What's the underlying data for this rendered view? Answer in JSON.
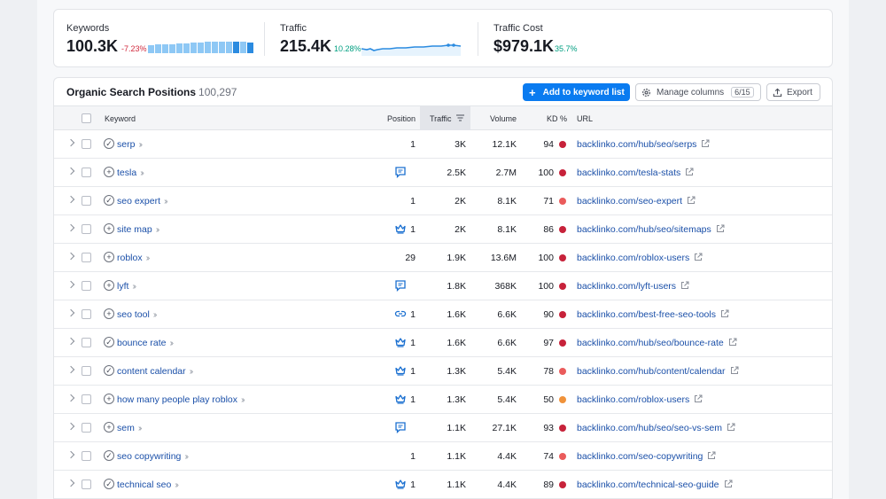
{
  "summary": {
    "keywords": {
      "label": "Keywords",
      "value": "100.3K",
      "change": "-7.23%",
      "change_color": "#d1293d"
    },
    "traffic": {
      "label": "Traffic",
      "value": "215.4K",
      "change": "10.28%",
      "change_color": "#009f81"
    },
    "traffic_cost": {
      "label": "Traffic Cost",
      "value": "$979.1K",
      "change": "35.7%",
      "change_color": "#009f81"
    }
  },
  "table": {
    "title": "Organic Search Positions",
    "count": "100,297",
    "add_button": "Add to keyword list",
    "manage_button": "Manage columns",
    "manage_badge": "6/15",
    "export_button": "Export",
    "headers": {
      "keyword": "Keyword",
      "position": "Position",
      "traffic": "Traffic",
      "volume": "Volume",
      "kd": "KD %",
      "url": "URL"
    },
    "rows": [
      {
        "intent": "check-circle-icon",
        "keyword": "serp",
        "feature": "",
        "position": "1",
        "traffic": "3K",
        "volume": "12.1K",
        "kd": "94",
        "kd_color": "#c7223a",
        "url": "backlinko.com/hub/seo/serps"
      },
      {
        "intent": "plus-circle-icon",
        "keyword": "tesla",
        "feature": "review-icon",
        "position": "",
        "traffic": "2.5K",
        "volume": "2.7M",
        "kd": "100",
        "kd_color": "#c7223a",
        "url": "backlinko.com/tesla-stats"
      },
      {
        "intent": "check-circle-icon",
        "keyword": "seo expert",
        "feature": "",
        "position": "1",
        "traffic": "2K",
        "volume": "8.1K",
        "kd": "71",
        "kd_color": "#ea5b5b",
        "url": "backlinko.com/seo-expert"
      },
      {
        "intent": "plus-circle-icon",
        "keyword": "site map",
        "feature": "crown-icon",
        "position": "1",
        "traffic": "2K",
        "volume": "8.1K",
        "kd": "86",
        "kd_color": "#c7223a",
        "url": "backlinko.com/hub/seo/sitemaps"
      },
      {
        "intent": "plus-circle-icon",
        "keyword": "roblox",
        "feature": "",
        "position": "29",
        "traffic": "1.9K",
        "volume": "13.6M",
        "kd": "100",
        "kd_color": "#c7223a",
        "url": "backlinko.com/roblox-users"
      },
      {
        "intent": "plus-circle-icon",
        "keyword": "lyft",
        "feature": "review-icon",
        "position": "",
        "traffic": "1.8K",
        "volume": "368K",
        "kd": "100",
        "kd_color": "#c7223a",
        "url": "backlinko.com/lyft-users"
      },
      {
        "intent": "plus-circle-icon",
        "keyword": "seo tool",
        "feature": "link-icon",
        "position": "1",
        "traffic": "1.6K",
        "volume": "6.6K",
        "kd": "90",
        "kd_color": "#c7223a",
        "url": "backlinko.com/best-free-seo-tools"
      },
      {
        "intent": "check-circle-icon",
        "keyword": "bounce rate",
        "feature": "crown-icon",
        "position": "1",
        "traffic": "1.6K",
        "volume": "6.6K",
        "kd": "97",
        "kd_color": "#c7223a",
        "url": "backlinko.com/hub/seo/bounce-rate"
      },
      {
        "intent": "check-circle-icon",
        "keyword": "content calendar",
        "feature": "crown-icon",
        "position": "1",
        "traffic": "1.3K",
        "volume": "5.4K",
        "kd": "78",
        "kd_color": "#ea5b5b",
        "url": "backlinko.com/hub/content/calendar"
      },
      {
        "intent": "plus-circle-icon",
        "keyword": "how many people play roblox",
        "feature": "crown-icon",
        "position": "1",
        "traffic": "1.3K",
        "volume": "5.4K",
        "kd": "50",
        "kd_color": "#f0923a",
        "url": "backlinko.com/roblox-users"
      },
      {
        "intent": "plus-circle-icon",
        "keyword": "sem",
        "feature": "review-icon",
        "position": "",
        "traffic": "1.1K",
        "volume": "27.1K",
        "kd": "93",
        "kd_color": "#c7223a",
        "url": "backlinko.com/hub/seo/seo-vs-sem"
      },
      {
        "intent": "check-circle-icon",
        "keyword": "seo copywriting",
        "feature": "",
        "position": "1",
        "traffic": "1.1K",
        "volume": "4.4K",
        "kd": "74",
        "kd_color": "#ea5b5b",
        "url": "backlinko.com/seo-copywriting"
      },
      {
        "intent": "check-circle-icon",
        "keyword": "technical seo",
        "feature": "crown-icon",
        "position": "1",
        "traffic": "1.1K",
        "volume": "4.4K",
        "kd": "89",
        "kd_color": "#c7223a",
        "url": "backlinko.com/technical-seo-guide"
      }
    ]
  }
}
